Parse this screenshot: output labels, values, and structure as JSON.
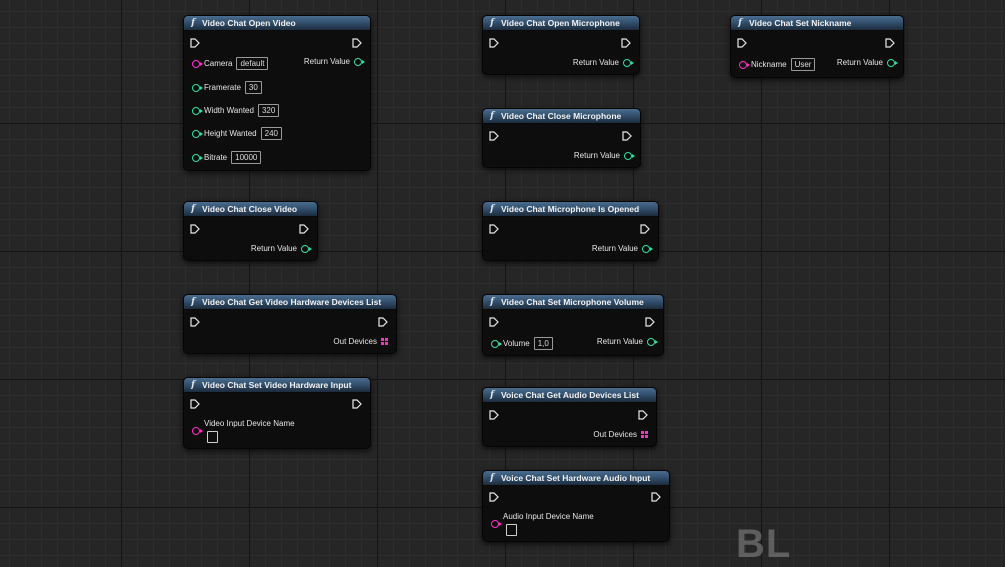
{
  "nodes": {
    "open_video": {
      "title": "Video Chat Open Video",
      "pins": {
        "camera": {
          "label": "Camera",
          "value": "default"
        },
        "framerate": {
          "label": "Framerate",
          "value": "30"
        },
        "width": {
          "label": "Width Wanted",
          "value": "320"
        },
        "height": {
          "label": "Height Wanted",
          "value": "240"
        },
        "bitrate": {
          "label": "Bitrate",
          "value": "10000"
        }
      },
      "return_label": "Return Value"
    },
    "close_video": {
      "title": "Video Chat Close Video",
      "return_label": "Return Value"
    },
    "get_video_devices": {
      "title": "Video Chat Get Video Hardware Devices List",
      "out_label": "Out Devices"
    },
    "set_video_input": {
      "title": "Video Chat Set Video Hardware Input",
      "input_label": "Video Input Device Name"
    },
    "open_mic": {
      "title": "Video Chat Open Microphone",
      "return_label": "Return Value"
    },
    "close_mic": {
      "title": "Video Chat Close Microphone",
      "return_label": "Return Value"
    },
    "mic_opened": {
      "title": "Video Chat Microphone Is Opened",
      "return_label": "Return Value"
    },
    "set_mic_volume": {
      "title": "Video Chat Set Microphone Volume",
      "volume_label": "Volume",
      "volume_value": "1,0",
      "return_label": "Return Value"
    },
    "get_audio_devices": {
      "title": "Voice Chat Get Audio Devices List",
      "out_label": "Out Devices"
    },
    "set_audio_input": {
      "title": "Voice Chat Set Hardware Audio Input",
      "input_label": "Audio Input Device Name"
    },
    "set_nickname": {
      "title": "Video Chat Set Nickname",
      "nickname_label": "Nickname",
      "nickname_value": "User",
      "return_label": "Return Value"
    }
  },
  "icons": {
    "function": "function-icon",
    "exec": "exec-pin-icon"
  },
  "watermark": "BL",
  "colors": {
    "header": "#3f5d7b",
    "pin_green": "#2fe0a0",
    "pin_magenta": "#ff2ec8",
    "background": "#262626"
  }
}
